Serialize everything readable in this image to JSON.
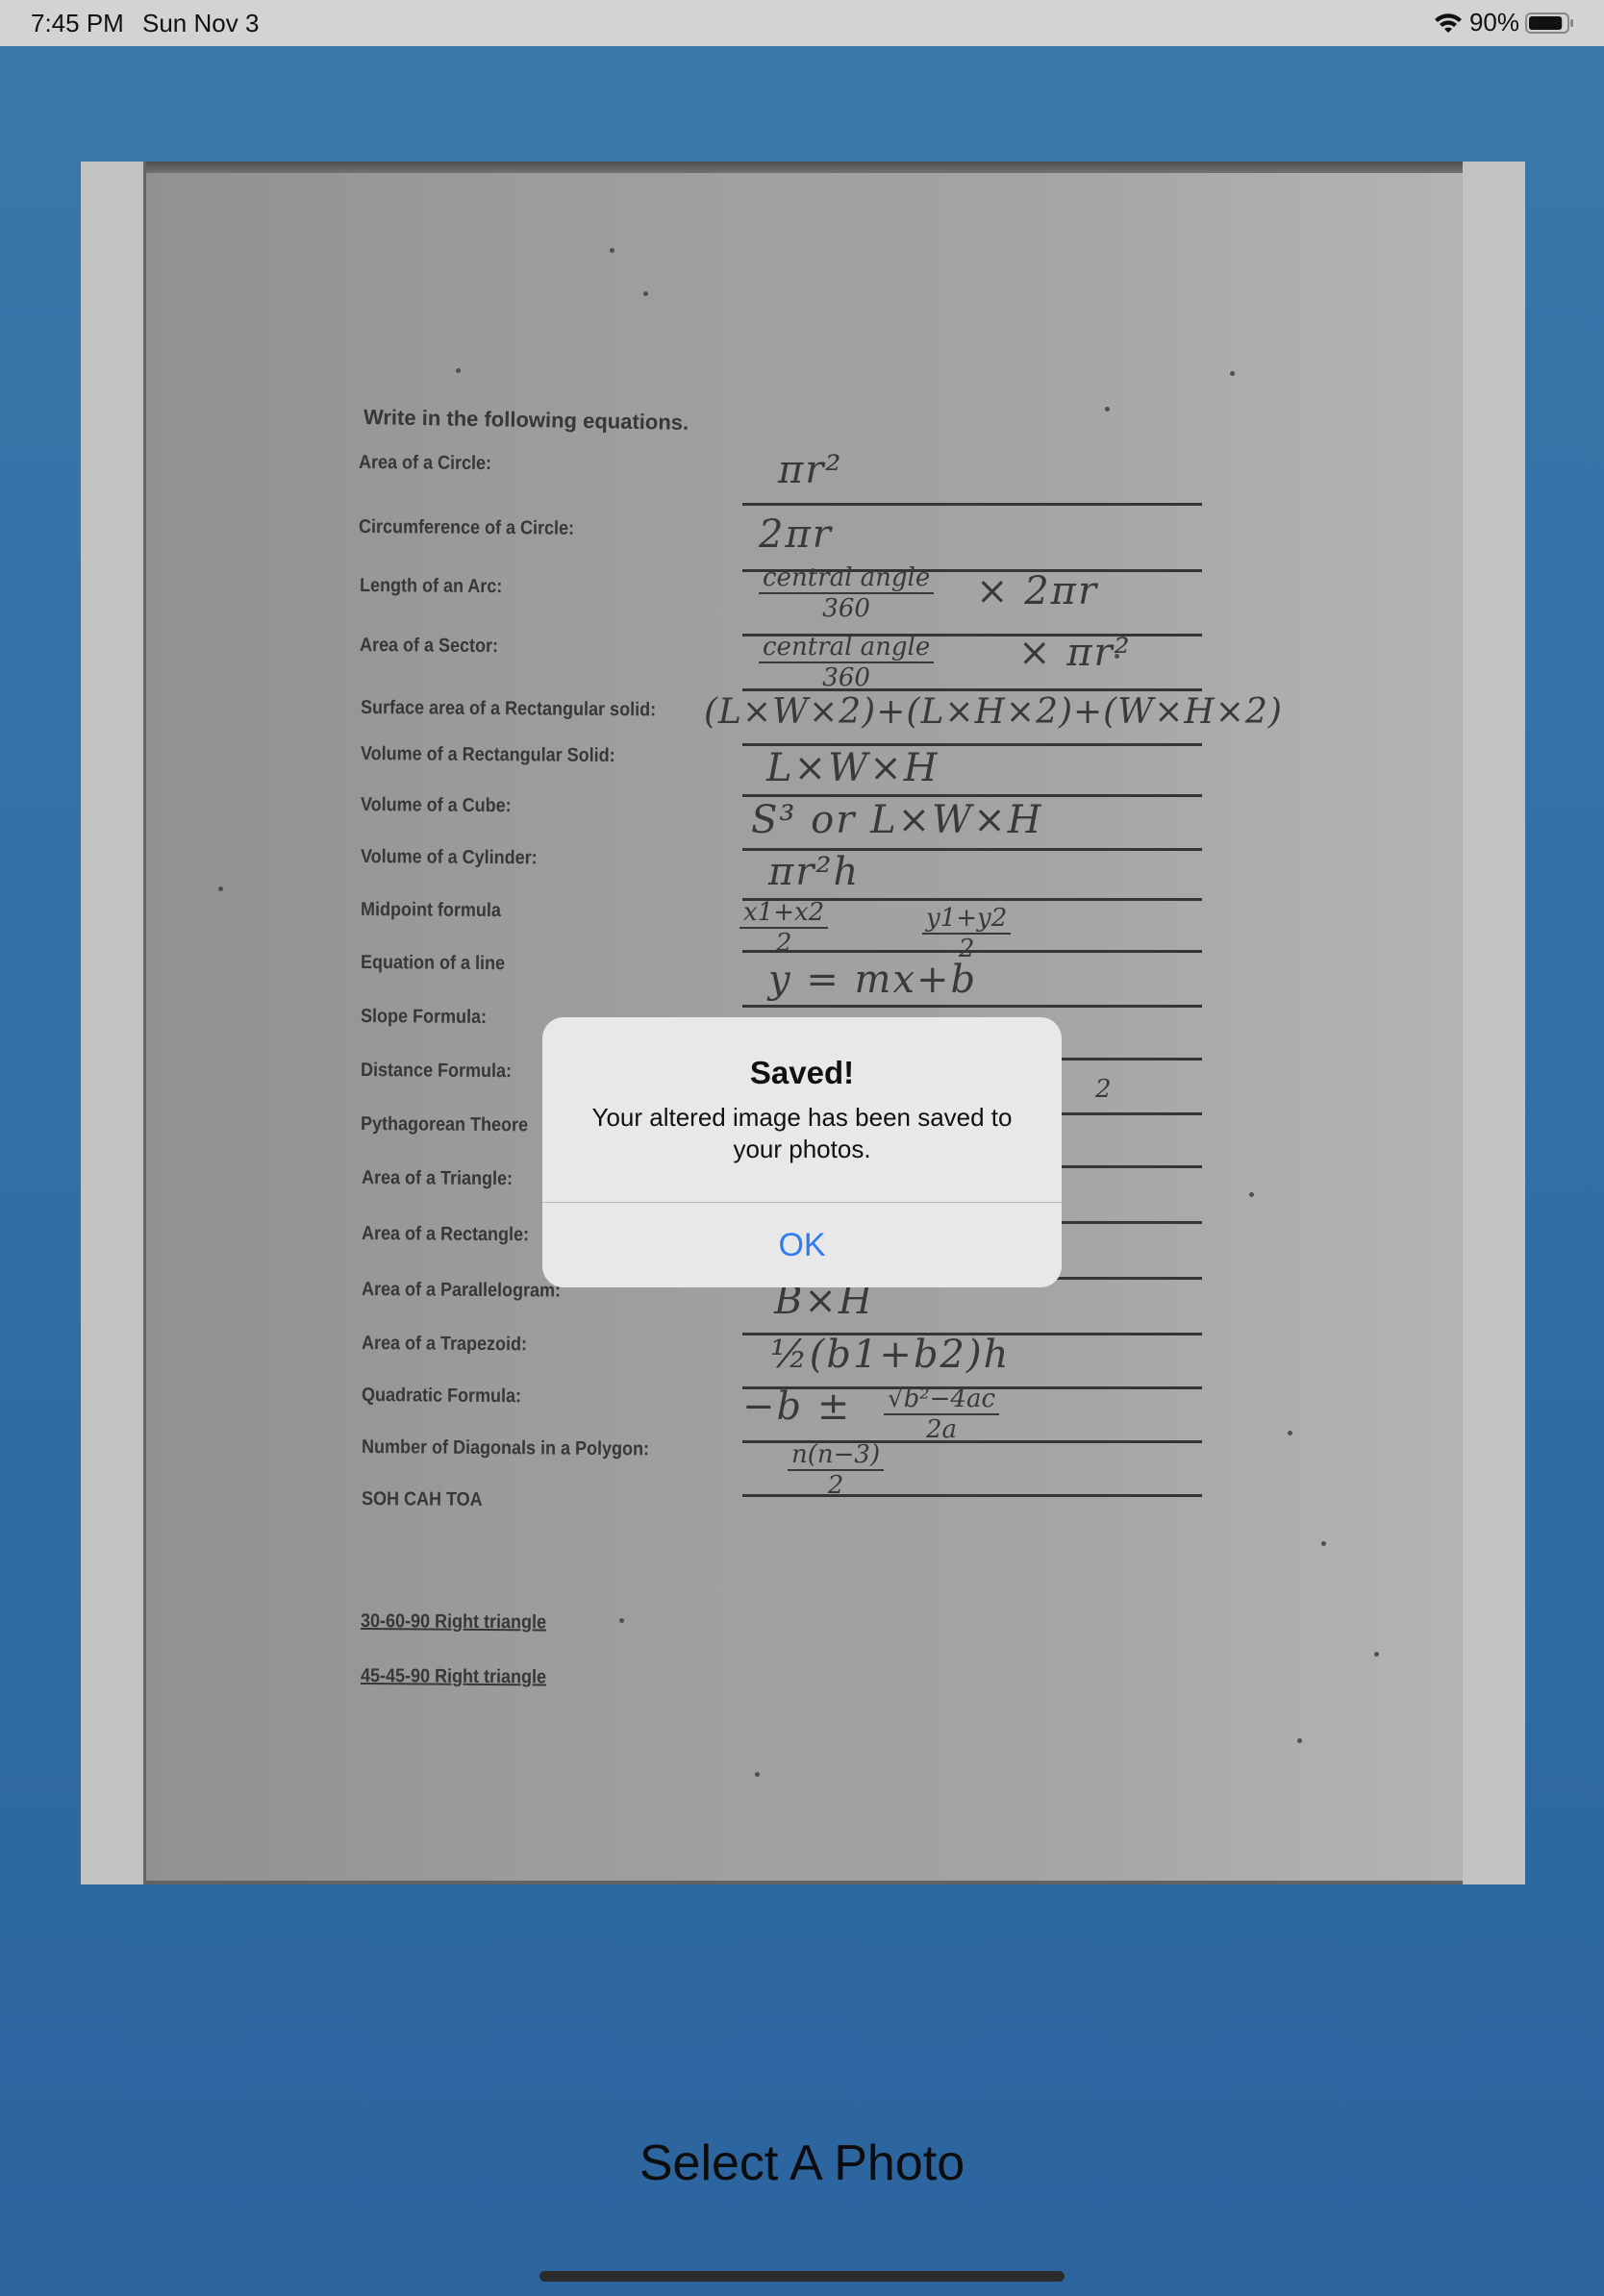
{
  "status_bar": {
    "time": "7:45 PM",
    "date": "Sun Nov 3",
    "battery": "90%",
    "battery_level": 0.9
  },
  "worksheet": {
    "heading": "Write in the following equations.",
    "labels": [
      "Area of a Circle:",
      "Circumference of a Circle:",
      "Length of an Arc:",
      "Area of a Sector:",
      "Surface area of a Rectangular solid:",
      "Volume of a Rectangular Solid:",
      "Volume of a Cube:",
      "Volume of a Cylinder:",
      "Midpoint formula",
      "Equation of a line",
      "Slope Formula:",
      "Distance Formula:",
      "Pythagorean Theore",
      "Area of a Triangle:",
      "Area of a Rectangle:",
      "Area of a Parallelogram:",
      "Area of a Trapezoid:",
      "Quadratic Formula:",
      "Number of Diagonals in a Polygon:",
      "SOH CAH TOA"
    ],
    "underlined_labels": [
      "30-60-90 Right triangle",
      "45-45-90 Right triangle"
    ],
    "answers": {
      "area_circle": "πr²",
      "circumference": "2πr",
      "arc_num": "central angle",
      "arc_den": "360",
      "arc_tail": "× 2πr",
      "sector_num": "central angle",
      "sector_den": "360",
      "sector_tail": "× πr²",
      "surface_area": "(L×W×2)+(L×H×2)+(W×H×2)",
      "volume_rect": "L×W×H",
      "volume_cube": "S³ or L×W×H",
      "volume_cylinder": "πr²h",
      "midpoint_x_num": "x1+x2",
      "midpoint_x_den": "2",
      "midpoint_y_num": "y1+y2",
      "midpoint_y_den": "2",
      "line": "y = mx+b",
      "distance_tail": "2",
      "parallelogram": "B×H",
      "trapezoid": "½(b1+b2)h",
      "quadratic_lead": "−b ±",
      "quadratic_num": "√b²−4ac",
      "quadratic_den": "2a",
      "diagonals_num": "n(n−3)",
      "diagonals_den": "2"
    }
  },
  "alert": {
    "title": "Saved!",
    "message": "Your altered image has been saved to your photos.",
    "ok_label": "OK"
  },
  "bottom": {
    "select_label": "Select A Photo"
  },
  "colors": {
    "background": "#3576b0",
    "alert_button": "#2f7bf3",
    "status_bar": "#d3d3d3"
  },
  "icons": [
    "wifi-icon",
    "battery-icon"
  ]
}
